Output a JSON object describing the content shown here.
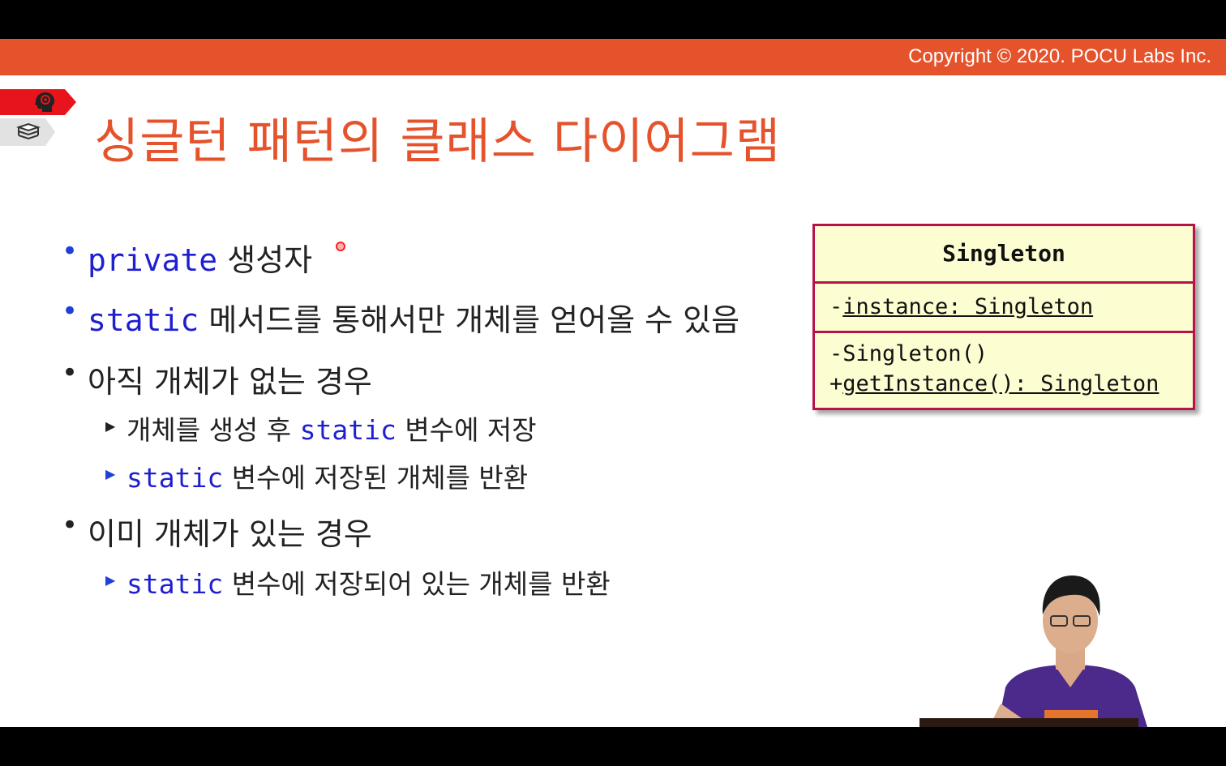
{
  "header": {
    "copyright": "Copyright © 2020. POCU Labs Inc."
  },
  "slide": {
    "title": "싱글턴 패턴의 클래스 다이어그램"
  },
  "bullets": [
    {
      "keyword": "private",
      "text": "생성자"
    },
    {
      "keyword": "static",
      "text": "메서드를 통해서만 개체를 얻어올 수 있음"
    },
    {
      "text": "아직 개체가 없는 경우",
      "sub": [
        {
          "pre": "개체를 생성 후",
          "keyword": "static",
          "post": "변수에 저장"
        },
        {
          "keyword": "static",
          "post": "변수에 저장된 개체를 반환"
        }
      ]
    },
    {
      "text": "이미 개체가 있는 경우",
      "sub": [
        {
          "keyword": "static",
          "post": "변수에 저장되어 있는 개체를 반환"
        }
      ]
    }
  ],
  "uml": {
    "class_name": "Singleton",
    "attribute": {
      "prefix": "-",
      "text": "instance: Singleton"
    },
    "methods": [
      {
        "prefix": "-",
        "text": "Singleton()"
      },
      {
        "prefix": "+",
        "text": "getInstance(): Singleton"
      }
    ]
  },
  "icons": [
    "brain-icon",
    "books-icon"
  ],
  "colors": {
    "accent": "#e5532c",
    "keyword": "#1f1fd0",
    "uml_border": "#b8124a",
    "uml_fill": "#fdfdd2"
  }
}
